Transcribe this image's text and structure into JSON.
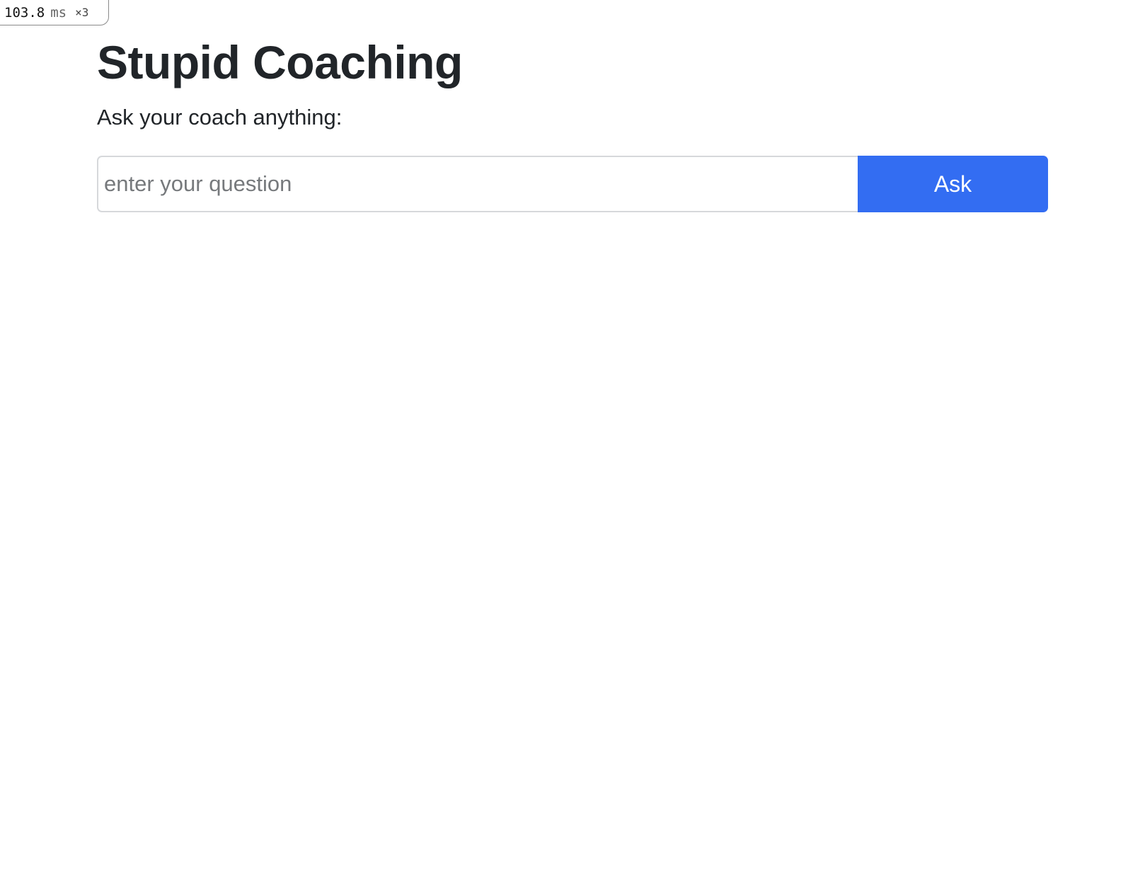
{
  "perf_badge": {
    "value": "103.8",
    "unit": "ms",
    "count": "×3"
  },
  "header": {
    "title": "Stupid Coaching"
  },
  "form": {
    "label": "Ask your coach anything:",
    "question_placeholder": "enter your question",
    "question_value": "",
    "ask_label": "Ask"
  },
  "colors": {
    "accent": "#336df2",
    "text": "#212529",
    "placeholder": "#76797c",
    "input_border": "#d6d8db"
  }
}
